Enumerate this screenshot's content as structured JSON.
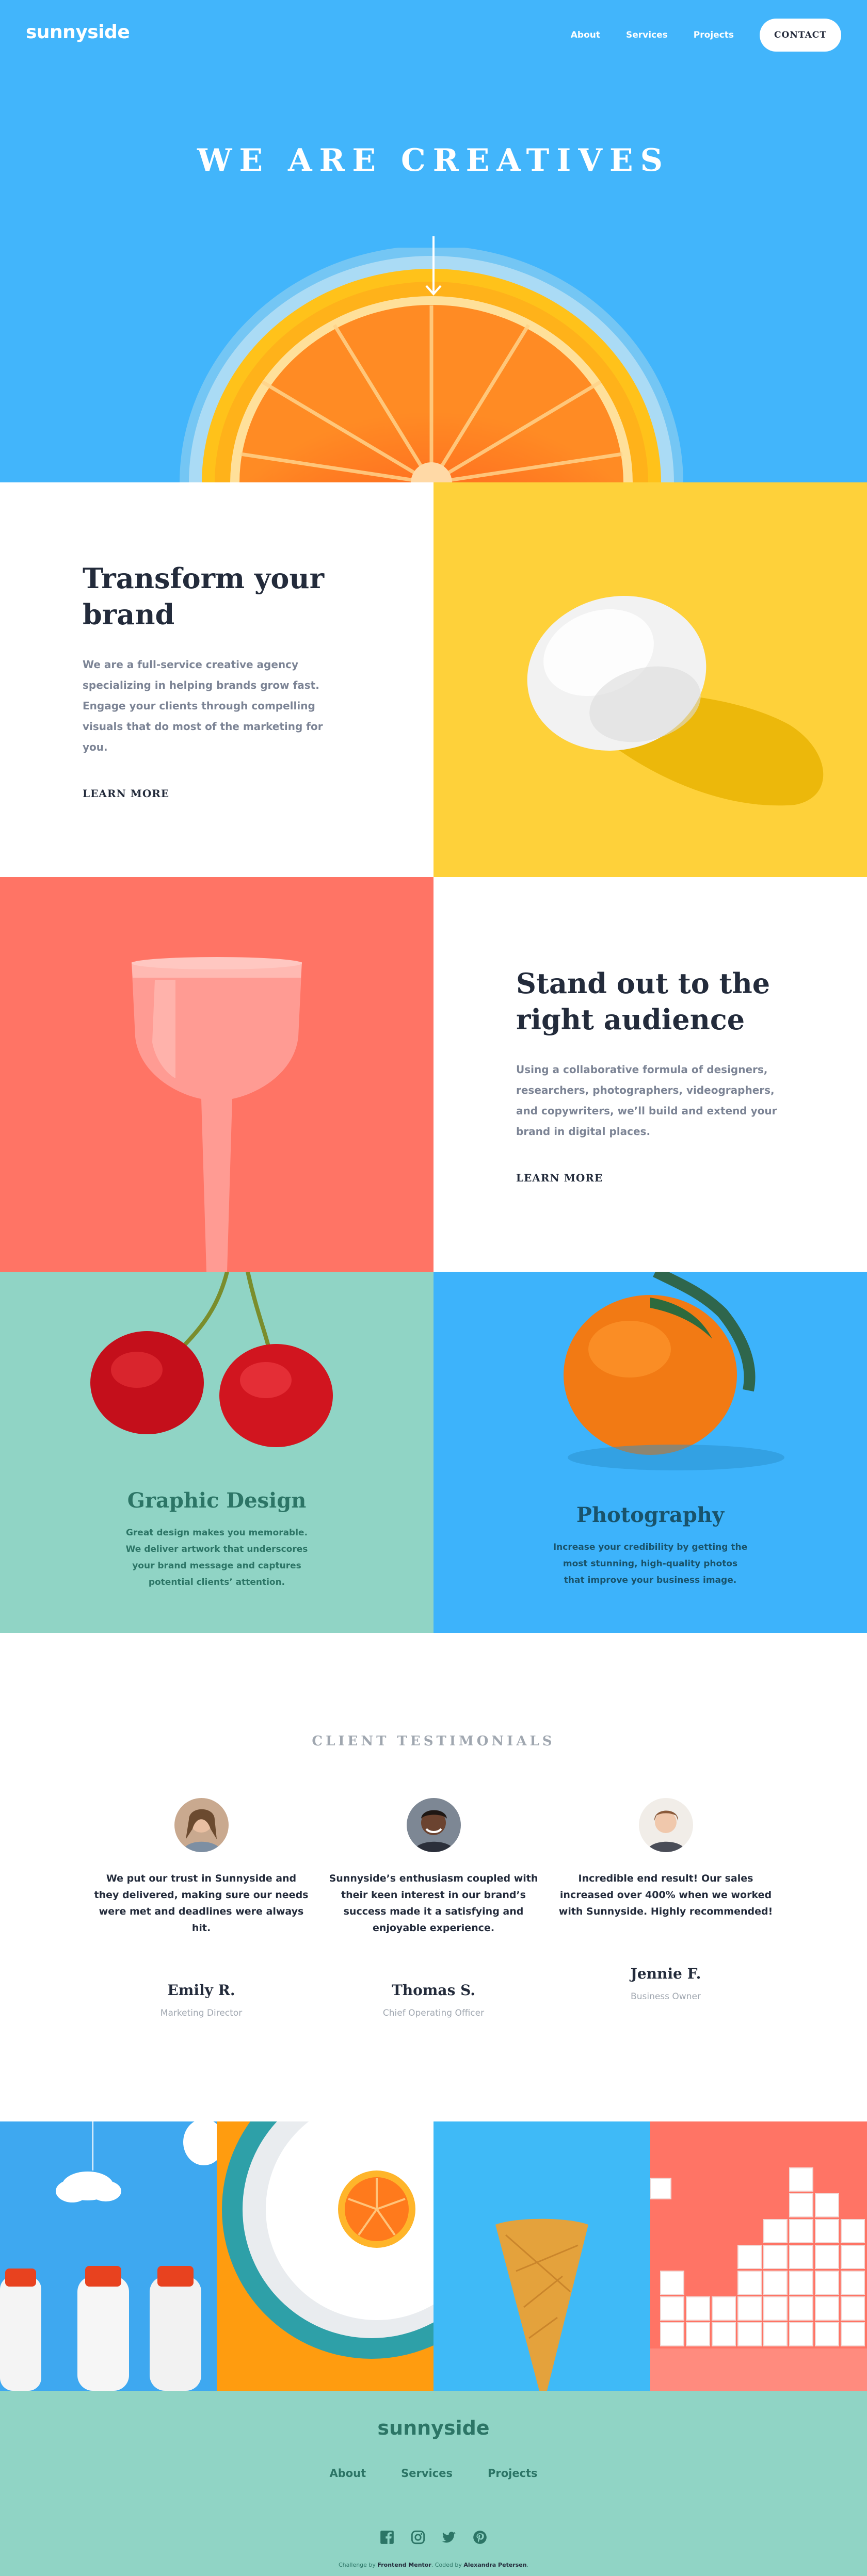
{
  "header": {
    "logo": "sunnyside",
    "nav": [
      {
        "label": "About"
      },
      {
        "label": "Services"
      },
      {
        "label": "Projects"
      }
    ],
    "contact_label": "CONTACT"
  },
  "hero": {
    "title": "WE ARE CREATIVES",
    "arrow_icon": "arrow-down-icon"
  },
  "features": [
    {
      "title": "Transform your brand",
      "body": "We are a full-service creative agency specializing in helping brands grow fast. Engage your clients through compelling visuals that do most of the marketing for you.",
      "link": "LEARN MORE",
      "accent": "#fad400"
    },
    {
      "title": "Stand out to the right audience",
      "body": "Using a collaborative formula of designers, researchers, photographers, videographers, and copywriters, we’ll build and extend your brand in digital places.",
      "link": "LEARN MORE",
      "accent": "#fe7766"
    }
  ],
  "services": [
    {
      "title": "Graphic Design",
      "body": "Great design makes you memorable. We deliver artwork that underscores your brand message and captures potential clients’ attention.",
      "color": "#2c7566"
    },
    {
      "title": "Photography",
      "body": "Increase your credibility by getting the most stunning, high-quality photos that improve your business image.",
      "color": "#19536b"
    }
  ],
  "testimonials": {
    "heading": "CLIENT TESTIMONIALS",
    "items": [
      {
        "quote": "We put our trust in Sunnyside and they delivered, making sure our needs were met and deadlines were always hit.",
        "name": "Emily R.",
        "role": "Marketing Director"
      },
      {
        "quote": "Sunnyside’s enthusiasm coupled with their keen interest in our brand’s success made it a satisfying and enjoyable experience.",
        "name": "Thomas S.",
        "role": "Chief Operating Officer"
      },
      {
        "quote": "Incredible end result! Our sales increased over 400% when we worked with Sunnyside. Highly recommended!",
        "name": "Jennie F.",
        "role": "Business Owner"
      }
    ]
  },
  "footer": {
    "logo": "sunnyside",
    "nav": [
      {
        "label": "About"
      },
      {
        "label": "Services"
      },
      {
        "label": "Projects"
      }
    ],
    "social": [
      "facebook-icon",
      "instagram-icon",
      "twitter-icon",
      "pinterest-icon"
    ],
    "attribution_prefix": "Challenge by",
    "attribution_fm": "Frontend Mentor",
    "attribution_mid": ". Coded by",
    "attribution_author": "Alexandra Petersen",
    "attribution_suffix": "."
  },
  "colors": {
    "hero_blue": "#42b5fb",
    "yellow": "#fed13a",
    "coral": "#ff7465",
    "mint": "#90d4c5",
    "dark": "#232b3b",
    "grey": "#7c8495"
  }
}
